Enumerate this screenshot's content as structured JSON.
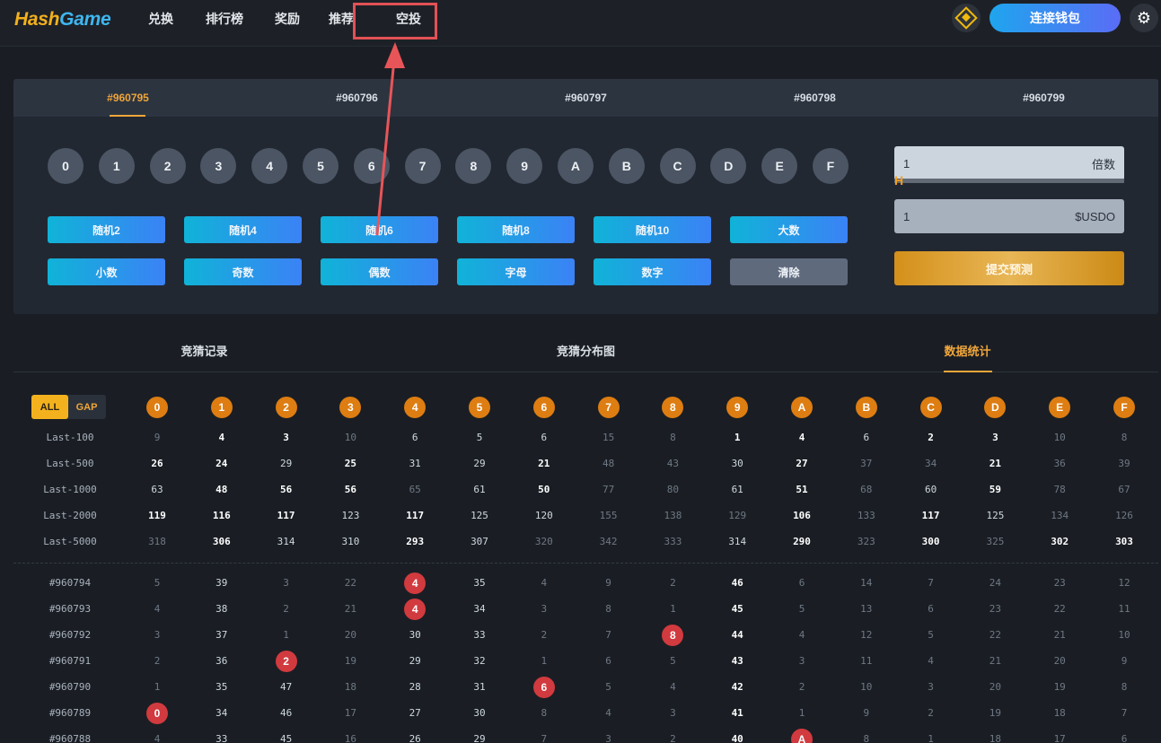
{
  "header": {
    "logo_part1": "Hash",
    "logo_part2": "Game",
    "nav": [
      "兑换",
      "排行榜",
      "奖励",
      "推荐",
      "空投"
    ],
    "wallet_button": "连接钱包"
  },
  "bet_panel": {
    "rounds": [
      "#960795",
      "#960796",
      "#960797",
      "#960798",
      "#960799"
    ],
    "active_round": 0,
    "digits": [
      "0",
      "1",
      "2",
      "3",
      "4",
      "5",
      "6",
      "7",
      "8",
      "9",
      "A",
      "B",
      "C",
      "D",
      "E",
      "F"
    ],
    "quick_buttons": [
      "随机2",
      "随机4",
      "随机6",
      "随机8",
      "随机10",
      "大数",
      "小数",
      "奇数",
      "偶数",
      "字母",
      "数字",
      "清除"
    ],
    "multiplier_value": "1",
    "multiplier_unit": "倍数",
    "amount_value": "1",
    "amount_unit": "$USDO",
    "slider_thumb_glyph": "H",
    "submit_label": "提交预测"
  },
  "section_tabs": [
    "竞猜记录",
    "竞猜分布图",
    "数据统计"
  ],
  "active_section": 2,
  "stats": {
    "mode_all": "ALL",
    "mode_gap": "GAP",
    "columns": [
      "0",
      "1",
      "2",
      "3",
      "4",
      "5",
      "6",
      "7",
      "8",
      "9",
      "A",
      "B",
      "C",
      "D",
      "E",
      "F"
    ],
    "summary_rows": [
      {
        "label": "Last-100",
        "values": [
          9,
          4,
          3,
          10,
          6,
          5,
          6,
          15,
          8,
          1,
          4,
          6,
          2,
          3,
          10,
          8
        ]
      },
      {
        "label": "Last-500",
        "values": [
          26,
          24,
          29,
          25,
          31,
          29,
          21,
          48,
          43,
          30,
          27,
          37,
          34,
          21,
          36,
          39
        ]
      },
      {
        "label": "Last-1000",
        "values": [
          63,
          48,
          56,
          56,
          65,
          61,
          50,
          77,
          80,
          61,
          51,
          68,
          60,
          59,
          78,
          67
        ]
      },
      {
        "label": "Last-2000",
        "values": [
          119,
          116,
          117,
          123,
          117,
          125,
          120,
          155,
          138,
          129,
          106,
          133,
          117,
          125,
          134,
          126
        ]
      },
      {
        "label": "Last-5000",
        "values": [
          318,
          306,
          314,
          310,
          293,
          307,
          320,
          342,
          333,
          314,
          290,
          323,
          300,
          325,
          302,
          303
        ]
      }
    ],
    "history_rows": [
      {
        "label": "#960794",
        "values": [
          5,
          39,
          3,
          22,
          "4",
          35,
          4,
          9,
          2,
          46,
          6,
          14,
          7,
          24,
          23,
          12
        ],
        "hit": 4
      },
      {
        "label": "#960793",
        "values": [
          4,
          38,
          2,
          21,
          "4",
          34,
          3,
          8,
          1,
          45,
          5,
          13,
          6,
          23,
          22,
          11
        ],
        "hit": 4
      },
      {
        "label": "#960792",
        "values": [
          3,
          37,
          1,
          20,
          30,
          33,
          2,
          7,
          "8",
          44,
          4,
          12,
          5,
          22,
          21,
          10
        ],
        "hit": 8
      },
      {
        "label": "#960791",
        "values": [
          2,
          36,
          "2",
          19,
          29,
          32,
          1,
          6,
          5,
          43,
          3,
          11,
          4,
          21,
          20,
          9
        ],
        "hit": 2
      },
      {
        "label": "#960790",
        "values": [
          1,
          35,
          47,
          18,
          28,
          31,
          "6",
          5,
          4,
          42,
          2,
          10,
          3,
          20,
          19,
          8
        ],
        "hit": 6
      },
      {
        "label": "#960789",
        "values": [
          "0",
          34,
          46,
          17,
          27,
          30,
          8,
          4,
          3,
          41,
          1,
          9,
          2,
          19,
          18,
          7
        ],
        "hit": 0
      },
      {
        "label": "#960788",
        "values": [
          4,
          33,
          45,
          16,
          26,
          29,
          7,
          3,
          2,
          40,
          "A",
          8,
          1,
          18,
          17,
          6
        ],
        "hit": 10
      }
    ]
  }
}
